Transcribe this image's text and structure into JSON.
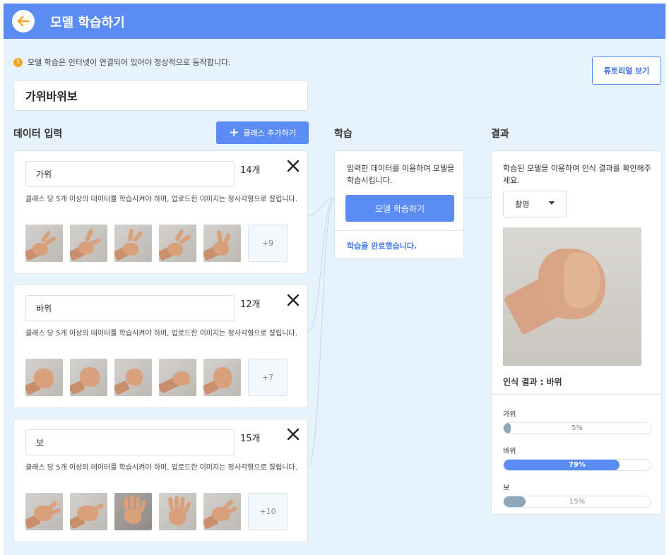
{
  "header": {
    "title": "모델 학습하기",
    "back_icon": "arrow-left-icon"
  },
  "notice": {
    "text": "모델 학습은 인터넷이 연결되어 있어야 정상적으로 동작합니다.",
    "icon": "warning-icon"
  },
  "tutorial_button": "튜토리얼 보기",
  "project_name": "가위바위보",
  "data_input": {
    "title": "데이터 입력",
    "add_class_label": "클래스 추가하기",
    "classes": [
      {
        "name": "가위",
        "count": "14개",
        "hint": "클래스 당 5개 이상의 데이터를 학습시켜야 하며, 업로드한 이미지는 정사각형으로 잘립니다.",
        "more": "+9",
        "gesture": "scissors"
      },
      {
        "name": "바위",
        "count": "12개",
        "hint": "클래스 당 5개 이상의 데이터를 학습시켜야 하며, 업로드한 이미지는 정사각형으로 잘립니다.",
        "more": "+7",
        "gesture": "rock"
      },
      {
        "name": "보",
        "count": "15개",
        "hint": "클래스 당 5개 이상의 데이터를 학습시켜야 하며, 업로드한 이미지는 정사각형으로 잘립니다.",
        "more": "+10",
        "gesture": "paper"
      }
    ]
  },
  "training": {
    "title": "학습",
    "description": "입력한 데이터를 이용하여 모델을 학습시킵니다.",
    "button": "모델 학습하기",
    "status": "학습을 완료했습니다."
  },
  "result": {
    "title": "결과",
    "description": "학습된 모델을 이용하여 인식 결과를 확인해주세요.",
    "mode_select": "촬영",
    "recognition": "인식 결과 : 바위",
    "probabilities": [
      {
        "label": "가위",
        "value": 5,
        "text": "5%",
        "color": "#8fa5b8"
      },
      {
        "label": "바위",
        "value": 79,
        "text": "79%",
        "color": "#5b8cf3"
      },
      {
        "label": "보",
        "value": 15,
        "text": "15%",
        "color": "#8fa5b8"
      }
    ]
  },
  "colors": {
    "accent": "#5b8cf3",
    "background": "#e6f2fc",
    "warning": "#f5a623"
  }
}
